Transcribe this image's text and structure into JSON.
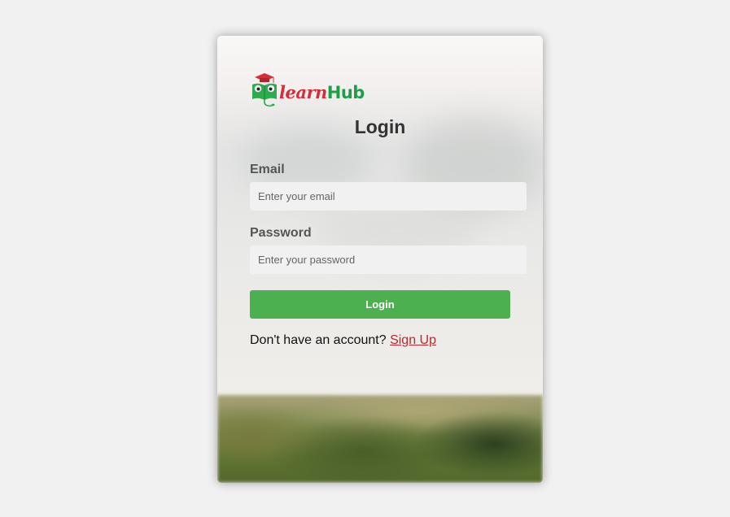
{
  "logo": {
    "brand_part1": "learn",
    "brand_part2": "Hub",
    "icon": "owl-book-icon"
  },
  "form": {
    "title": "Login",
    "email": {
      "label": "Email",
      "placeholder": "Enter your email",
      "value": ""
    },
    "password": {
      "label": "Password",
      "placeholder": "Enter your password",
      "value": ""
    },
    "submit_label": "Login",
    "signup_prompt": "Don't have an account?",
    "signup_link": "Sign Up"
  },
  "colors": {
    "page_bg": "#f1f1f1",
    "button": "#4caf50",
    "link": "#c0272d",
    "brand_red": "#d62d3a",
    "brand_green": "#1f9e4a"
  }
}
